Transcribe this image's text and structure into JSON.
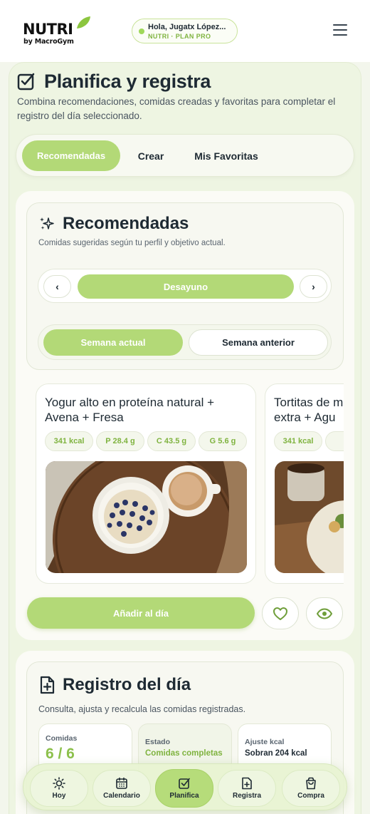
{
  "header": {
    "logo_main": "NUTRI",
    "logo_sub": "by MacroGym",
    "user_greeting": "Hola, Jugatx López...",
    "user_plan": "NUTRI · PLAN PRO"
  },
  "page": {
    "title": "Planifica y registra",
    "description": "Combina recomendaciones, comidas creadas y favoritas para completar el registro del día seleccionado."
  },
  "tabs": [
    {
      "label": "Recomendadas",
      "active": true
    },
    {
      "label": "Crear",
      "active": false
    },
    {
      "label": "Mis Favoritas",
      "active": false
    }
  ],
  "recommendations": {
    "title": "Recomendadas",
    "subtitle": "Comidas sugeridas según tu perfil y objetivo actual.",
    "meal_selector": {
      "prev": "‹",
      "current": "Desayuno",
      "next": "›"
    },
    "week_selector": {
      "current": "Semana actual",
      "previous": "Semana anterior"
    },
    "cards": [
      {
        "name_line1": "Yogur alto en proteína natural +",
        "name_line2": "Avena + Fresa",
        "kcal": "341 kcal",
        "protein": "P 28.4 g",
        "carbs": "C 43.5 g",
        "fat": "G 5.6 g"
      },
      {
        "name_line1": "Tortitas de m",
        "name_line2": "extra + Agu",
        "kcal": "341 kcal",
        "protein": "P 2"
      }
    ],
    "add_button": "Añadir al día"
  },
  "registro": {
    "title": "Registro del día",
    "subtitle": "Consulta, ajusta y recalcula las comidas registradas.",
    "stats": [
      {
        "label": "Comidas",
        "value": "6 / 6"
      },
      {
        "label": "Estado",
        "value": "Comidas completas"
      },
      {
        "label": "Ajuste kcal",
        "value": "Sobran 204 kcal"
      }
    ]
  },
  "bottom_nav": [
    {
      "label": "Hoy",
      "icon": "sun-icon"
    },
    {
      "label": "Calendario",
      "icon": "calendar-icon"
    },
    {
      "label": "Planifica",
      "icon": "checkbox-icon",
      "active": true
    },
    {
      "label": "Registra",
      "icon": "add-file-icon"
    },
    {
      "label": "Compra",
      "icon": "shopping-bag-icon"
    }
  ],
  "colors": {
    "accent": "#b3d977",
    "accent_text": "#7fb33f",
    "text": "#1e2a33",
    "background": "#f3f6ec"
  }
}
